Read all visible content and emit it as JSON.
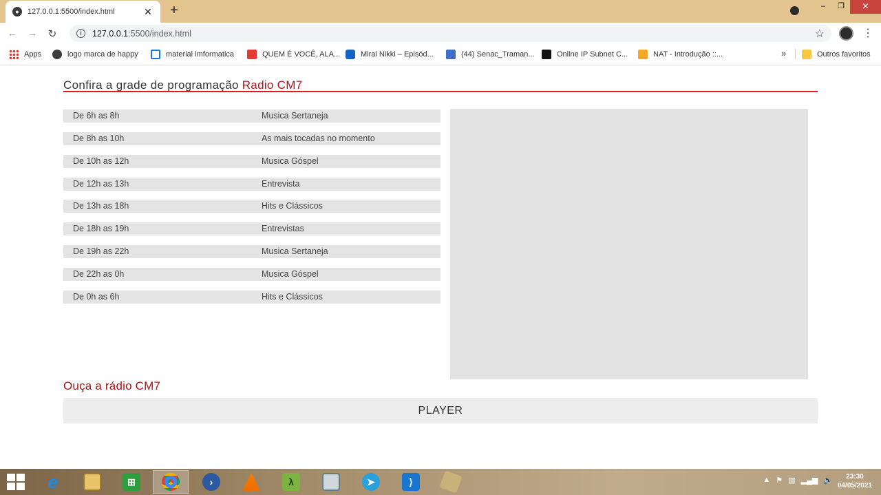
{
  "browser": {
    "tab_title": "127.0.0.1:5500/index.html",
    "tab_close": "✕",
    "new_tab": "+",
    "url_host": "127.0.0.1",
    "url_rest": ":5500/index.html",
    "bookmarks": [
      {
        "label": "Apps",
        "icon": "apps-grid-icon"
      },
      {
        "label": "logo marca de happy",
        "icon": "globe-icon"
      },
      {
        "label": "material imformatica",
        "icon": "doc-icon"
      },
      {
        "label": "QUEM É VOCÊ, ALA...",
        "icon": "pdf-icon"
      },
      {
        "label": "Mirai Nikki – Episód...",
        "icon": "play-icon"
      },
      {
        "label": "(44) Senac_Traman...",
        "icon": "chat-icon"
      },
      {
        "label": "Online IP Subnet C...",
        "icon": "subnet-icon"
      },
      {
        "label": "NAT - Introdução ::...",
        "icon": "nat-icon"
      }
    ],
    "bookmarks_more": "»",
    "other_bookmarks": "Outros favoritos"
  },
  "page": {
    "heading_prefix": "Confira a grade de programação",
    "heading_accent": "Radio CM7",
    "schedule": [
      {
        "time": "De 6h as 8h",
        "show": "Musica Sertaneja"
      },
      {
        "time": "De 8h as 10h",
        "show": "As mais tocadas no momento"
      },
      {
        "time": "De 10h as 12h",
        "show": "Musica Góspel"
      },
      {
        "time": "De 12h as 13h",
        "show": "Entrevista"
      },
      {
        "time": "De 13h as 18h",
        "show": "Hits e Clássicos"
      },
      {
        "time": "De 18h as 19h",
        "show": "Entrevistas"
      },
      {
        "time": "De 19h as 22h",
        "show": "Musica Sertaneja"
      },
      {
        "time": "De 22h as 0h",
        "show": "Musica Góspel"
      },
      {
        "time": "De 0h as 6h",
        "show": "Hits e Clássicos"
      }
    ],
    "listen_title": "Ouça a rádio CM7",
    "player_label": "PLAYER"
  },
  "taskbar": {
    "time": "23:30",
    "date": "04/05/2021"
  },
  "colors": {
    "accent": "#b31217",
    "rule": "#d81e1e",
    "row_bg": "#e4e4e4",
    "tabstrip": "#e4c48e"
  }
}
